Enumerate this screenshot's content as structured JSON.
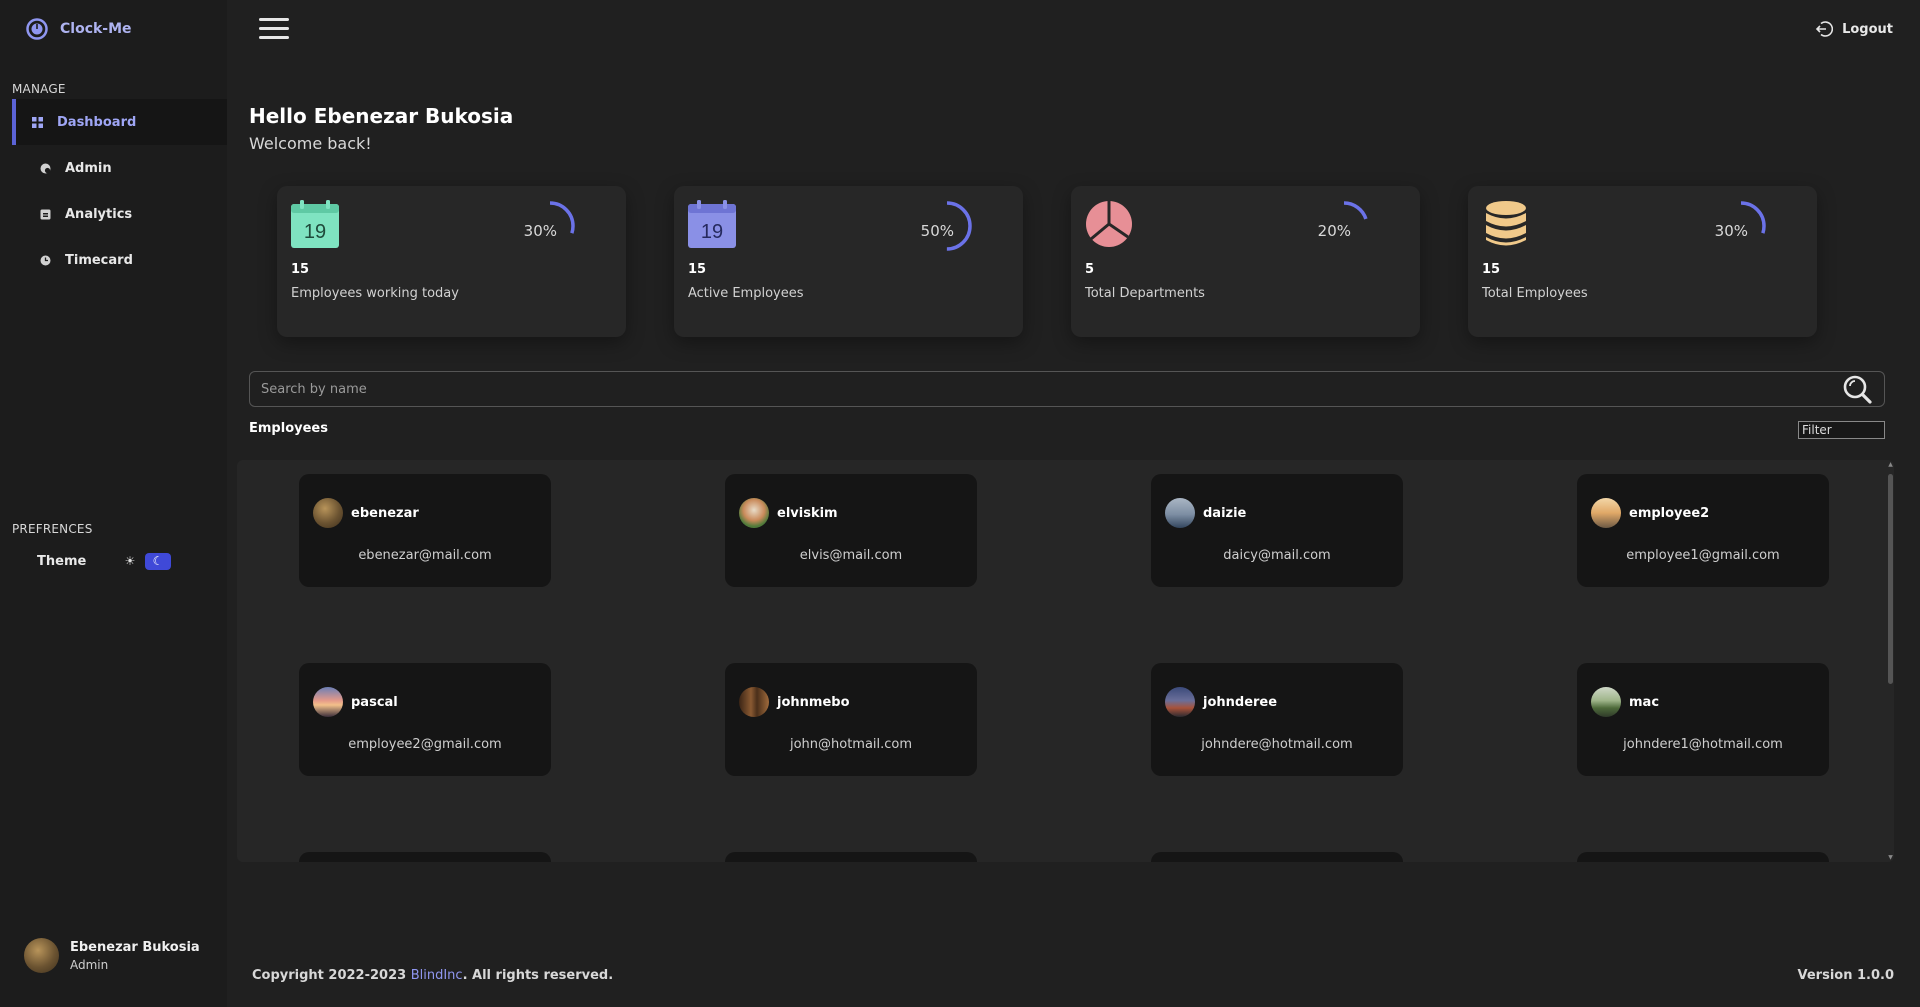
{
  "app": {
    "name": "Clock-Me"
  },
  "sidebar": {
    "manage_label": "MANAGE",
    "items": [
      {
        "label": "Dashboard",
        "icon": "grid-icon",
        "active": true
      },
      {
        "label": "Admin",
        "icon": "admin-icon",
        "active": false
      },
      {
        "label": "Analytics",
        "icon": "analytics-icon",
        "active": false
      },
      {
        "label": "Timecard",
        "icon": "clock-icon",
        "active": false
      }
    ],
    "preferences_label": "PREFRENCES",
    "theme_label": "Theme",
    "theme_mode": "dark"
  },
  "profile": {
    "name": "Ebenezar Bukosia",
    "role": "Admin"
  },
  "header": {
    "logout_label": "Logout"
  },
  "greeting": {
    "title": "Hello Ebenezar Bukosia",
    "subtitle": "Welcome back!"
  },
  "stats": [
    {
      "icon": "calendar-icon",
      "icon_text": "19",
      "icon_color": "#7fe3c1",
      "percent_label": "30%",
      "percent": 30,
      "value": "15",
      "label": "Employees working today"
    },
    {
      "icon": "calendar-icon",
      "icon_text": "19",
      "icon_color": "#8a90e6",
      "percent_label": "50%",
      "percent": 50,
      "value": "15",
      "label": "Active Employees"
    },
    {
      "icon": "pie-icon",
      "icon_color": "#e78f96",
      "percent_label": "20%",
      "percent": 20,
      "value": "5",
      "label": "Total Departments"
    },
    {
      "icon": "database-icon",
      "icon_color": "#f0c98a",
      "percent_label": "30%",
      "percent": 30,
      "value": "15",
      "label": "Total Employees"
    }
  ],
  "ring_color": "#6b72e8",
  "search": {
    "placeholder": "Search by name"
  },
  "employees": {
    "title": "Employees",
    "filter_placeholder": "Filter",
    "list": [
      {
        "name": "ebenezar",
        "email": "ebenezar@mail.com"
      },
      {
        "name": "elviskim",
        "email": "elvis@mail.com"
      },
      {
        "name": "daizie",
        "email": "daicy@mail.com"
      },
      {
        "name": "employee2",
        "email": "employee1@gmail.com"
      },
      {
        "name": "pascal",
        "email": "employee2@gmail.com"
      },
      {
        "name": "johnmebo",
        "email": "john@hotmail.com"
      },
      {
        "name": "johnderee",
        "email": "johndere@hotmail.com"
      },
      {
        "name": "mac",
        "email": "johndere1@hotmail.com"
      }
    ]
  },
  "footer": {
    "copyright_prefix": "Copyright 2022-2023 ",
    "company": "BlindInc",
    "copyright_suffix": ". All rights reserved.",
    "version": "Version 1.0.0"
  }
}
